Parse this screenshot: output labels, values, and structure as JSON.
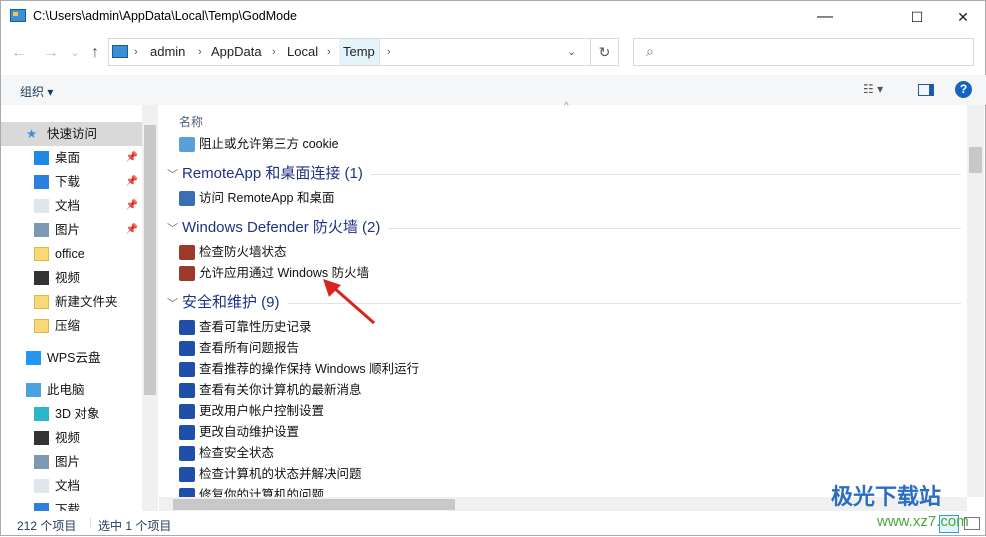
{
  "window": {
    "title": "C:\\Users\\admin\\AppData\\Local\\Temp\\GodMode",
    "minimize": "—",
    "maximize": "☐",
    "close": "✕"
  },
  "nav": {
    "back": "←",
    "forward": "→",
    "recent": "⌄",
    "up": "↑",
    "breadcrumb": [
      "admin",
      "AppData",
      "Local",
      "Temp"
    ],
    "refresh": "↻",
    "search_placeholder": ""
  },
  "toolbar": {
    "organize": "组织 ▾",
    "view": "☷ ▾",
    "help": "?"
  },
  "sidebar": {
    "items": [
      {
        "label": "快速访问",
        "icon": "star-icon",
        "color": "#3a8fd6",
        "sel": true,
        "indent": 0
      },
      {
        "label": "桌面",
        "icon": "desktop-icon",
        "color": "#1e88e5",
        "pin": true,
        "indent": 1
      },
      {
        "label": "下载",
        "icon": "download-icon",
        "color": "#2f7fe0",
        "pin": true,
        "indent": 1
      },
      {
        "label": "文档",
        "icon": "document-icon",
        "color": "#dfe6ee",
        "pin": true,
        "indent": 1
      },
      {
        "label": "图片",
        "icon": "pictures-icon",
        "color": "#7b98b5",
        "pin": true,
        "indent": 1
      },
      {
        "label": "office",
        "icon": "folder-icon",
        "color": "#f8d978",
        "indent": 1
      },
      {
        "label": "视频",
        "icon": "video-icon",
        "color": "#333",
        "indent": 1
      },
      {
        "label": "新建文件夹",
        "icon": "folder-icon",
        "color": "#f8d978",
        "indent": 1
      },
      {
        "label": "压缩",
        "icon": "folder-icon",
        "color": "#f8d978",
        "indent": 1
      },
      {
        "label": "WPS云盘",
        "icon": "cloud-icon",
        "color": "#2196f3",
        "indent": 0,
        "gap": 8
      },
      {
        "label": "此电脑",
        "icon": "computer-icon",
        "color": "#4aa3e0",
        "indent": 0,
        "gap": 8
      },
      {
        "label": "3D 对象",
        "icon": "cube-icon",
        "color": "#29b6c8",
        "indent": 1
      },
      {
        "label": "视频",
        "icon": "video-icon",
        "color": "#333",
        "indent": 1
      },
      {
        "label": "图片",
        "icon": "pictures-icon",
        "color": "#7b98b5",
        "indent": 1
      },
      {
        "label": "文档",
        "icon": "document-icon",
        "color": "#dfe6ee",
        "indent": 1
      },
      {
        "label": "下载",
        "icon": "download-icon",
        "color": "#2f7fe0",
        "indent": 1
      }
    ]
  },
  "main": {
    "column_name": "名称",
    "rows": [
      {
        "type": "item",
        "label": "阻止或允许第三方 cookie",
        "icon": "internet-options-icon",
        "color": "#5aa0d8"
      },
      {
        "type": "group",
        "label": "RemoteApp 和桌面连接 (1)"
      },
      {
        "type": "item",
        "label": "访问 RemoteApp 和桌面",
        "icon": "remoteapp-icon",
        "color": "#3b6fb5"
      },
      {
        "type": "group",
        "label": "Windows Defender 防火墙 (2)"
      },
      {
        "type": "item",
        "label": "检查防火墙状态",
        "icon": "firewall-icon",
        "color": "#9b3a2a"
      },
      {
        "type": "item",
        "label": "允许应用通过 Windows 防火墙",
        "icon": "firewall-icon",
        "color": "#9b3a2a"
      },
      {
        "type": "group",
        "label": "安全和维护 (9)"
      },
      {
        "type": "item",
        "label": "查看可靠性历史记录",
        "icon": "flag-icon",
        "color": "#1f4fa8"
      },
      {
        "type": "item",
        "label": "查看所有问题报告",
        "icon": "flag-icon",
        "color": "#1f4fa8"
      },
      {
        "type": "item",
        "label": "查看推荐的操作保持 Windows 顺利运行",
        "icon": "flag-icon",
        "color": "#1f4fa8"
      },
      {
        "type": "item",
        "label": "查看有关你计算机的最新消息",
        "icon": "flag-icon",
        "color": "#1f4fa8"
      },
      {
        "type": "item",
        "label": "更改用户帐户控制设置",
        "icon": "flag-icon",
        "color": "#1f4fa8"
      },
      {
        "type": "item",
        "label": "更改自动维护设置",
        "icon": "flag-icon",
        "color": "#1f4fa8"
      },
      {
        "type": "item",
        "label": "检查安全状态",
        "icon": "flag-icon",
        "color": "#1f4fa8"
      },
      {
        "type": "item",
        "label": "检查计算机的状态并解决问题",
        "icon": "flag-icon",
        "color": "#1f4fa8"
      },
      {
        "type": "item",
        "label": "修复你的计算机的问题",
        "icon": "flag-icon",
        "color": "#1f4fa8"
      }
    ]
  },
  "status": {
    "count": "212 个项目",
    "selected": "选中 1 个项目"
  },
  "watermark": {
    "text": "极光下载站",
    "url": "www.xz7.com"
  }
}
